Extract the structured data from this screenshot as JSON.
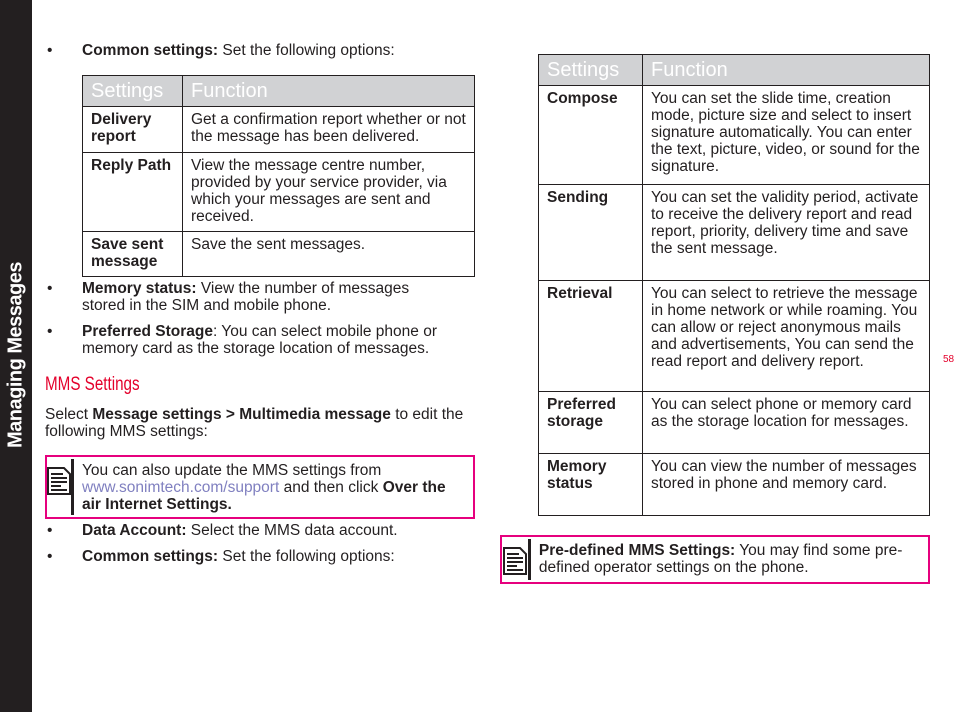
{
  "sidebar": {
    "title": "Managing Messages"
  },
  "page_number": "58",
  "left": {
    "bullet1": {
      "bold": "Common settings:",
      "text": " Set the following options:"
    },
    "table": {
      "headers": [
        "Settings",
        "Function"
      ],
      "rows": [
        {
          "setting": "Delivery report",
          "function": "Get a confirmation report whether or not the message has been delivered."
        },
        {
          "setting": "Reply Path",
          "function": "View the message centre number, provided by your service provider, via which your messages are sent and received."
        },
        {
          "setting": "Save sent message",
          "function": "Save the sent messages."
        }
      ]
    },
    "bullet2": {
      "bold": "Memory status:",
      "text": " View the number of messages stored in the SIM and mobile phone."
    },
    "bullet3": {
      "bold": "Preferred Storage",
      "text": ": You can select mobile phone or memory card as the storage location of messages."
    },
    "heading": "MMS Settings",
    "intro": {
      "pre": "Select ",
      "bold": "Message settings > Multimedia message",
      "post": " to edit the following MMS settings:"
    },
    "note": {
      "pre": "You can also update the MMS settings from ",
      "link": "www.sonimtech.com/support",
      "mid": " and then click ",
      "bold": "Over the air Internet Settings."
    },
    "bullet4": {
      "bold": "Data Account:",
      "text": " Select  the MMS data account."
    },
    "bullet5": {
      "bold": "Common settings:",
      "text": " Set the following options:"
    }
  },
  "right": {
    "table": {
      "headers": [
        "Settings",
        "Function"
      ],
      "rows": [
        {
          "setting": "Compose",
          "function": "You can set the slide time, creation mode, picture size and select to insert signature automatically. You can enter the text, picture, video, or sound for the signature."
        },
        {
          "setting": "Sending",
          "function": "You can set the validity period, activate to receive the delivery report and read report, priority, delivery time and save the sent message."
        },
        {
          "setting": "Retrieval",
          "function": "You can select to retrieve the message in home network or while roaming. You can allow or reject anonymous mails and advertisements, You can send the read report and delivery report."
        },
        {
          "setting": "Preferred storage",
          "function": "You can select phone or memory card as the storage location for messages."
        },
        {
          "setting": "Memory status",
          "function": "You can view the number of messages stored in phone and memory card."
        }
      ]
    },
    "note": {
      "bold": "Pre-defined MMS Settings:",
      "text": " You may find some pre-defined operator settings on the phone."
    }
  },
  "colors": {
    "accent": "#e6007e",
    "heading": "#e4002b",
    "sidebar": "#231f20",
    "table_header": "#d1d2d4",
    "link": "#8080c0"
  }
}
